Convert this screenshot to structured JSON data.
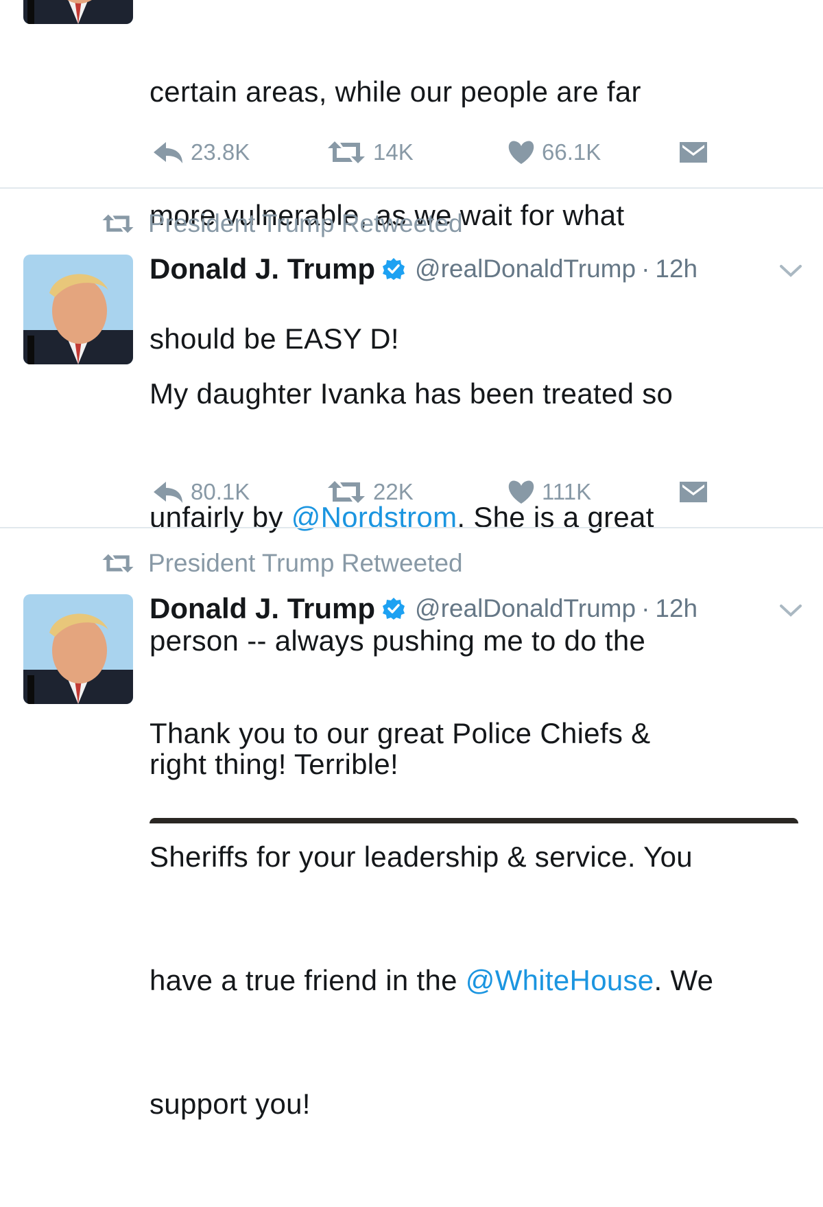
{
  "colors": {
    "text": "#14171a",
    "meta": "#657786",
    "action": "#8899a6",
    "link": "#1b95e0",
    "verified": "#1da1f2",
    "divider": "#e1e8ed"
  },
  "tweets": [
    {
      "text_lines": [
        "certain areas, while our people are far",
        "more vulnerable, as we wait for what",
        "should be EASY D!"
      ],
      "actions": {
        "reply": "23.8K",
        "retweet": "14K",
        "like": "66.1K"
      }
    },
    {
      "retweeted_by": "President Trump Retweeted",
      "name": "Donald J. Trump",
      "handle": "@realDonaldTrump",
      "separator": "·",
      "time": "12h",
      "text_parts": [
        [
          "My daughter Ivanka has been treated so"
        ],
        [
          "unfairly by ",
          "@Nordstrom",
          ". She is a great"
        ],
        [
          "person -- always pushing me to do the"
        ],
        [
          "right thing! Terrible!"
        ]
      ],
      "actions": {
        "reply": "80.1K",
        "retweet": "22K",
        "like": "111K"
      }
    },
    {
      "retweeted_by": "President Trump Retweeted",
      "name": "Donald J. Trump",
      "handle": "@realDonaldTrump",
      "separator": "·",
      "time": "12h",
      "text_parts": [
        [
          "Thank you to our great Police Chiefs &"
        ],
        [
          "Sheriffs for your leadership & service. You"
        ],
        [
          "have a true friend in the ",
          "@WhiteHouse",
          ". We"
        ],
        [
          "support you!"
        ]
      ]
    }
  ],
  "icons": {
    "reply": "reply-icon",
    "retweet": "retweet-icon",
    "like": "heart-icon",
    "dm": "envelope-icon",
    "verified": "verified-badge-icon",
    "caret": "chevron-down-icon"
  }
}
